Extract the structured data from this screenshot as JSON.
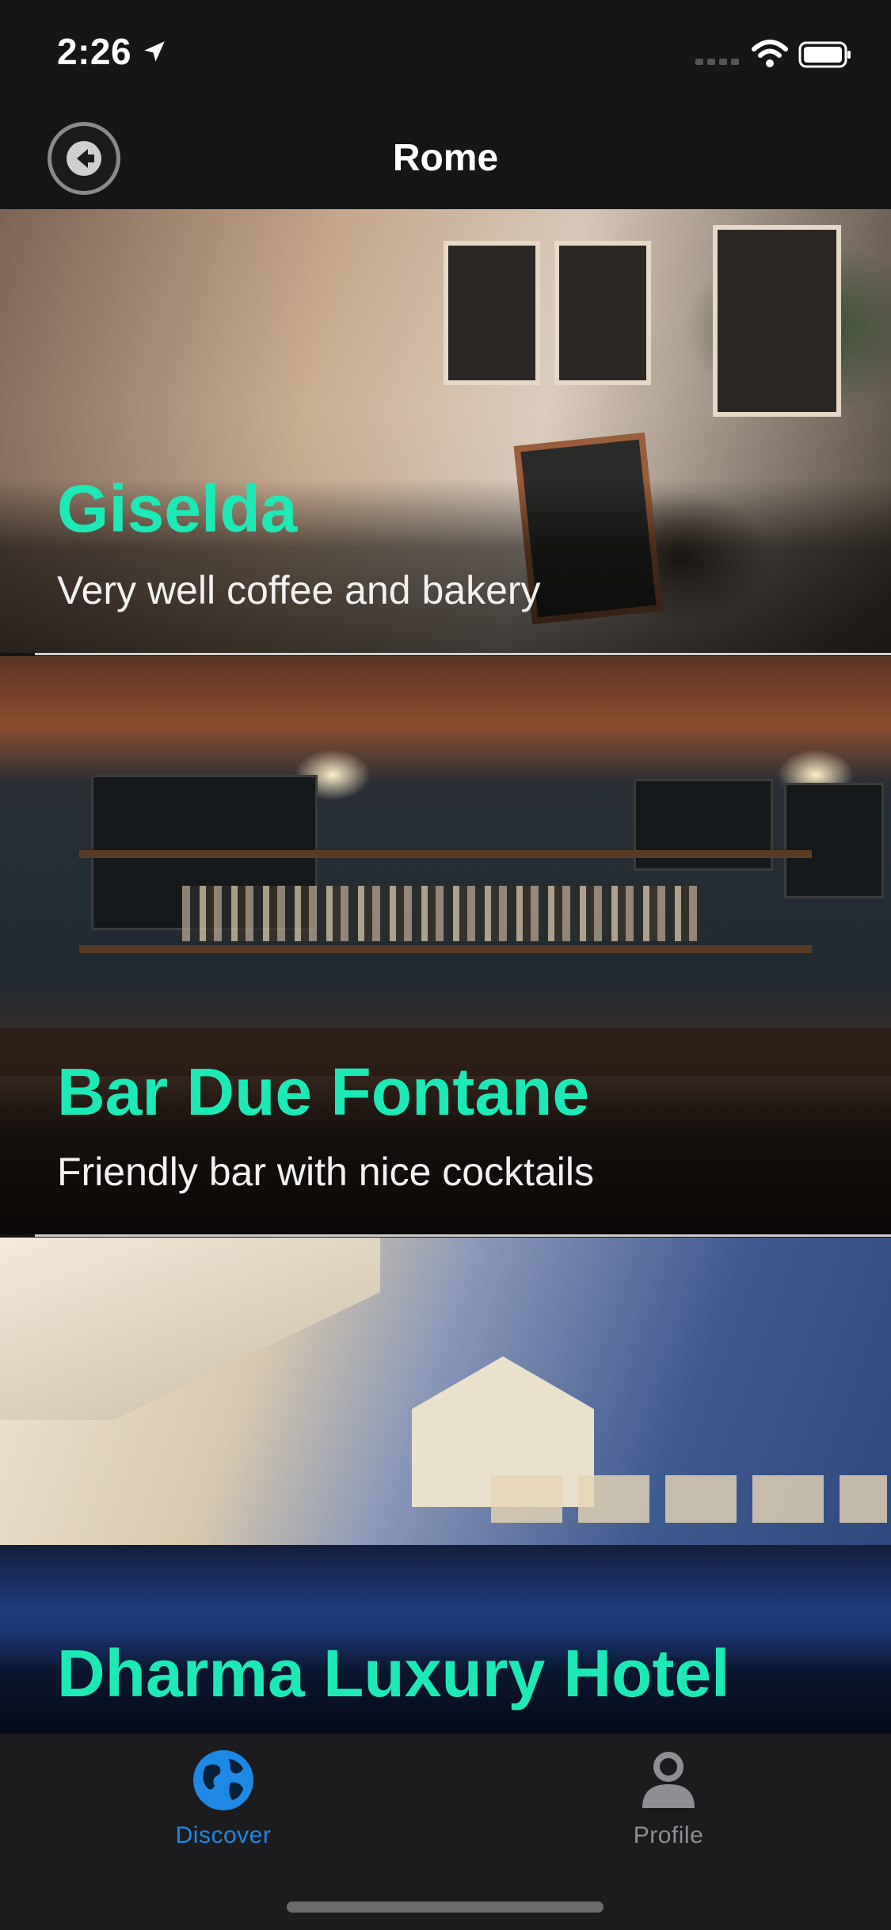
{
  "status_bar": {
    "time": "2:26"
  },
  "nav": {
    "title": "Rome"
  },
  "places": [
    {
      "name": "Giselda",
      "description": "Very well coffee and bakery"
    },
    {
      "name": "Bar Due Fontane",
      "description": "Friendly bar with nice cocktails"
    },
    {
      "name": "Dharma Luxury Hotel",
      "description": ""
    }
  ],
  "tabs": [
    {
      "label": "Discover",
      "icon": "globe-icon",
      "selected": true
    },
    {
      "label": "Profile",
      "icon": "person-icon",
      "selected": false
    }
  ],
  "colors": {
    "title_accent": "#1de9b6",
    "tab_selected": "#1e88e5",
    "tab_unselected": "#8e8e93"
  }
}
